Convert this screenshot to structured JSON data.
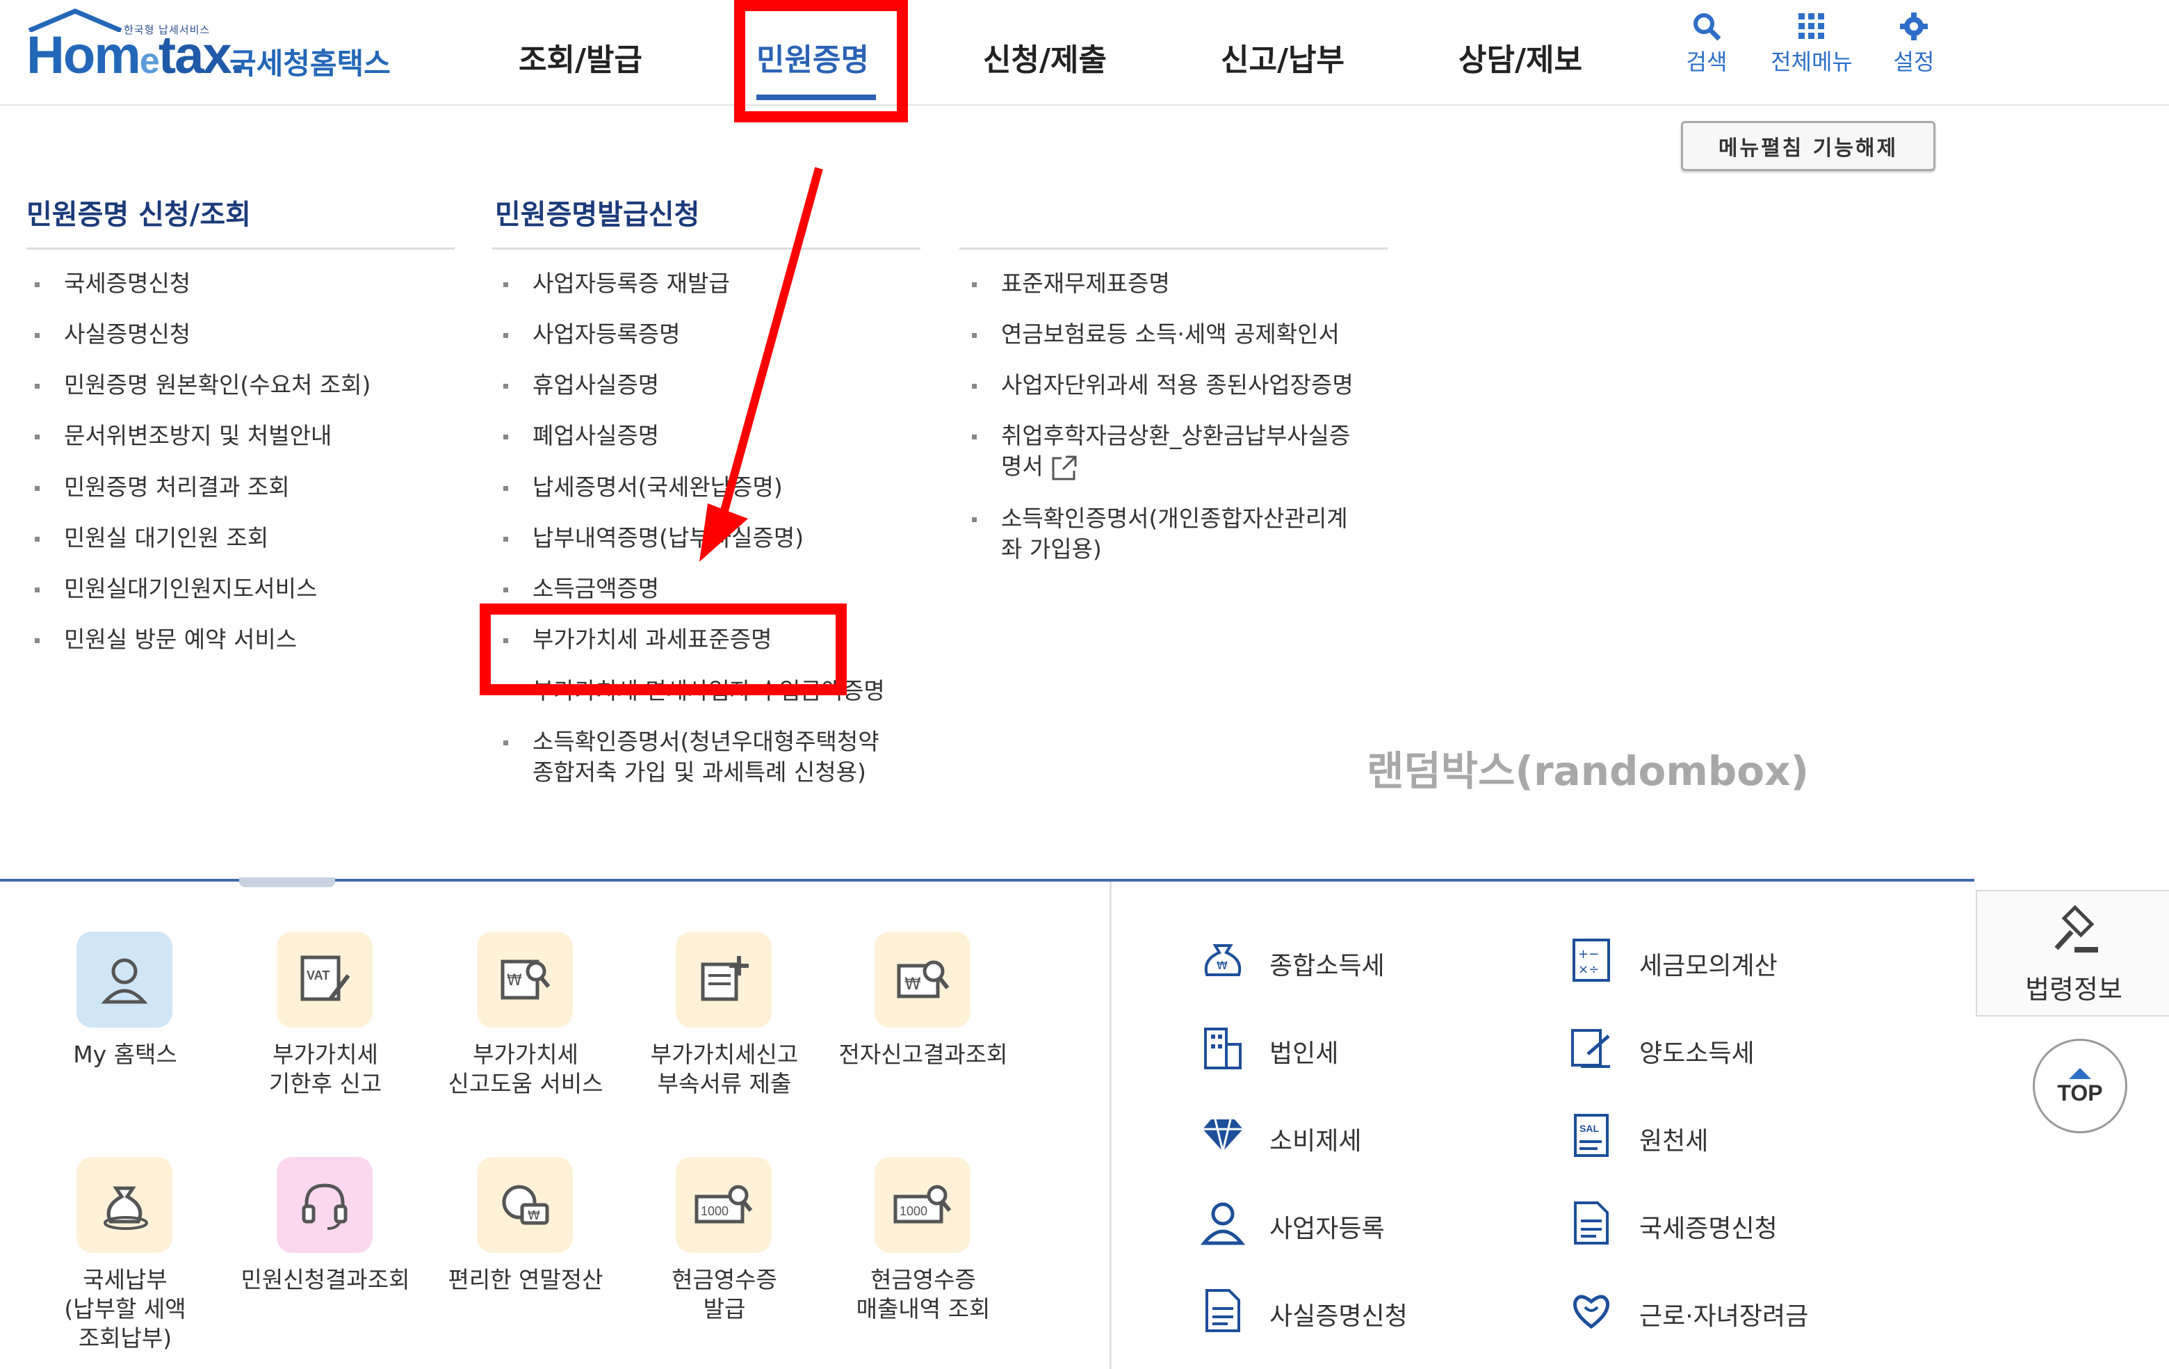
{
  "header": {
    "logo": {
      "small": "한국형 납세서비스",
      "brand_prefix": "Hom",
      "brand_e": "e",
      "brand_suffix": "tax.",
      "korean": "국세청홈택스"
    },
    "nav": [
      "조회/발급",
      "민원증명",
      "신청/제출",
      "신고/납부",
      "상담/제보"
    ],
    "active_nav": "민원증명",
    "utility": [
      {
        "icon": "search-icon",
        "label": "검색"
      },
      {
        "icon": "grid-menu-icon",
        "label": "전체메뉴"
      },
      {
        "icon": "gear-icon",
        "label": "설정"
      }
    ]
  },
  "menu_toggle_label": "메뉴펼침 기능해제",
  "columns": [
    {
      "title": "민원증명 신청/조회",
      "items": [
        "국세증명신청",
        "사실증명신청",
        "민원증명 원본확인(수요처 조회)",
        "문서위변조방지 및 처벌안내",
        "민원증명 처리결과 조회",
        "민원실 대기인원 조회",
        "민원실대기인원지도서비스",
        "민원실 방문 예약 서비스"
      ]
    },
    {
      "title": "민원증명발급신청",
      "items": [
        "사업자등록증 재발급",
        "사업자등록증명",
        "휴업사실증명",
        "폐업사실증명",
        "납세증명서(국세완납증명)",
        "납부내역증명(납부사실증명)",
        "소득금액증명",
        "부가가치세 과세표준증명",
        "부가가치세 면세사업자 수입금액증명",
        "소득확인증명서(청년우대형주택청약",
        "종합저축 가입 및 과세특례 신청용)"
      ]
    },
    {
      "title": "",
      "items": [
        "표준재무제표증명",
        "연금보험료등 소득·세액 공제확인서",
        "사업자단위과세 적용 종된사업장증명",
        "취업후학자금상환_상환금납부사실증",
        "명서",
        "소득확인증명서(개인종합자산관리계",
        "좌 가입용)"
      ]
    }
  ],
  "watermark": "랜덤박스(randombox)",
  "quick_services": [
    {
      "icon": "person-icon",
      "lines": [
        "My 홈택스"
      ],
      "bg": "#cfe6f7"
    },
    {
      "icon": "vat-pen-icon",
      "lines": [
        "부가가치세",
        "기한후 신고"
      ],
      "bg": "#fdf2d8"
    },
    {
      "icon": "document-search-icon",
      "lines": [
        "부가가치세",
        "신고도움 서비스"
      ],
      "bg": "#fdf2d8"
    },
    {
      "icon": "document-add-icon",
      "lines": [
        "부가가치세신고",
        "부속서류 제출"
      ],
      "bg": "#fdf2d8"
    },
    {
      "icon": "won-search-icon",
      "lines": [
        "전자신고결과조회"
      ],
      "bg": "#fdf2d8"
    },
    {
      "icon": "money-bag-icon",
      "lines": [
        "국세납부",
        "(납부할 세액",
        "조회납부)"
      ],
      "bg": "#fdf2d8"
    },
    {
      "icon": "headset-icon",
      "lines": [
        "민원신청결과조회"
      ],
      "bg": "#fcd7f0"
    },
    {
      "icon": "won-coin-icon",
      "lines": [
        "편리한 연말정산"
      ],
      "bg": "#fdf2d8"
    },
    {
      "icon": "receipt-search-icon",
      "lines": [
        "현금영수증",
        "발급"
      ],
      "bg": "#fdf2d8"
    },
    {
      "icon": "receipt-list-icon",
      "lines": [
        "현금영수증",
        "매출내역 조회"
      ],
      "bg": "#fdf2d8"
    }
  ],
  "receipt_number": "1000",
  "tax_links": [
    {
      "icon": "money-sack-icon",
      "label": "종합소득세"
    },
    {
      "icon": "calculator-icon",
      "label": "세금모의계산"
    },
    {
      "icon": "building-icon",
      "label": "법인세"
    },
    {
      "icon": "transfer-doc-icon",
      "label": "양도소득세"
    },
    {
      "icon": "diamond-icon",
      "label": "소비제세"
    },
    {
      "icon": "salary-doc-icon",
      "label": "원천세"
    },
    {
      "icon": "person-icon",
      "label": "사업자등록"
    },
    {
      "icon": "document-icon",
      "label": "국세증명신청"
    },
    {
      "icon": "document-icon",
      "label": "사실증명신청"
    },
    {
      "icon": "heart-hands-icon",
      "label": "근로·자녀장려금"
    }
  ],
  "side": {
    "law_label": "법령정보",
    "top_label": "TOP"
  }
}
